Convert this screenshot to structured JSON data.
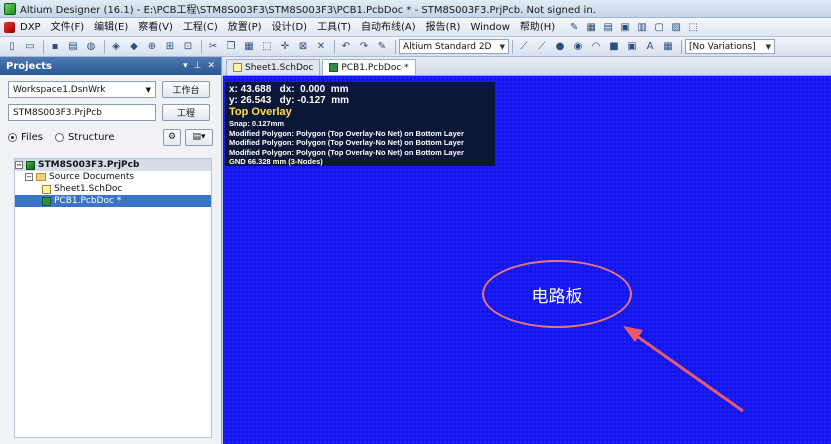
{
  "window": {
    "title": "Altium Designer (16.1) - E:\\PCB工程\\STM8S003F3\\STM8S003F3\\PCB1.PcbDoc * - STM8S003F3.PrjPcb. Not signed in."
  },
  "menu": {
    "items": [
      "DXP",
      "文件(F)",
      "编辑(E)",
      "察看(V)",
      "工程(C)",
      "放置(P)",
      "设计(D)",
      "工具(T)",
      "自动布线(A)",
      "报告(R)",
      "Window",
      "帮助(H)"
    ]
  },
  "toolbar": {
    "view_mode": "Altium Standard 2D",
    "variations": "[No Variations]"
  },
  "projects_panel": {
    "title": "Projects",
    "workspace": "Workspace1.DsnWrk",
    "workspace_button": "工作台",
    "project": "STM8S003F3.PrjPcb",
    "project_button": "工程",
    "view_files": "Files",
    "view_structure": "Structure",
    "tree": {
      "project": "STM8S003F3.PrjPcb",
      "folder": "Source Documents",
      "docs": [
        "Sheet1.SchDoc",
        "PCB1.PcbDoc *"
      ]
    }
  },
  "doc_tabs": [
    "Sheet1.SchDoc",
    "PCB1.PcbDoc *"
  ],
  "hud": {
    "line1": "x: 43.688   dx:  0.000  mm",
    "line2": "y: 26.543   dy: -0.127  mm",
    "layer": "Top Overlay",
    "snap": "Snap: 0.127mm",
    "msg1": "Modified Polygon: Polygon  (Top Overlay-No Net) on Bottom Layer",
    "msg2": "Modified Polygon: Polygon  (Top Overlay-No Net) on Bottom Layer",
    "msg3": "Modified Polygon: Polygon  (Top Overlay-No Net) on Bottom Layer",
    "gnd": "GND   66.328 mm  (3-Nodes)"
  },
  "canvas": {
    "annotation": "电路板",
    "bg_color": "#1414ee"
  }
}
